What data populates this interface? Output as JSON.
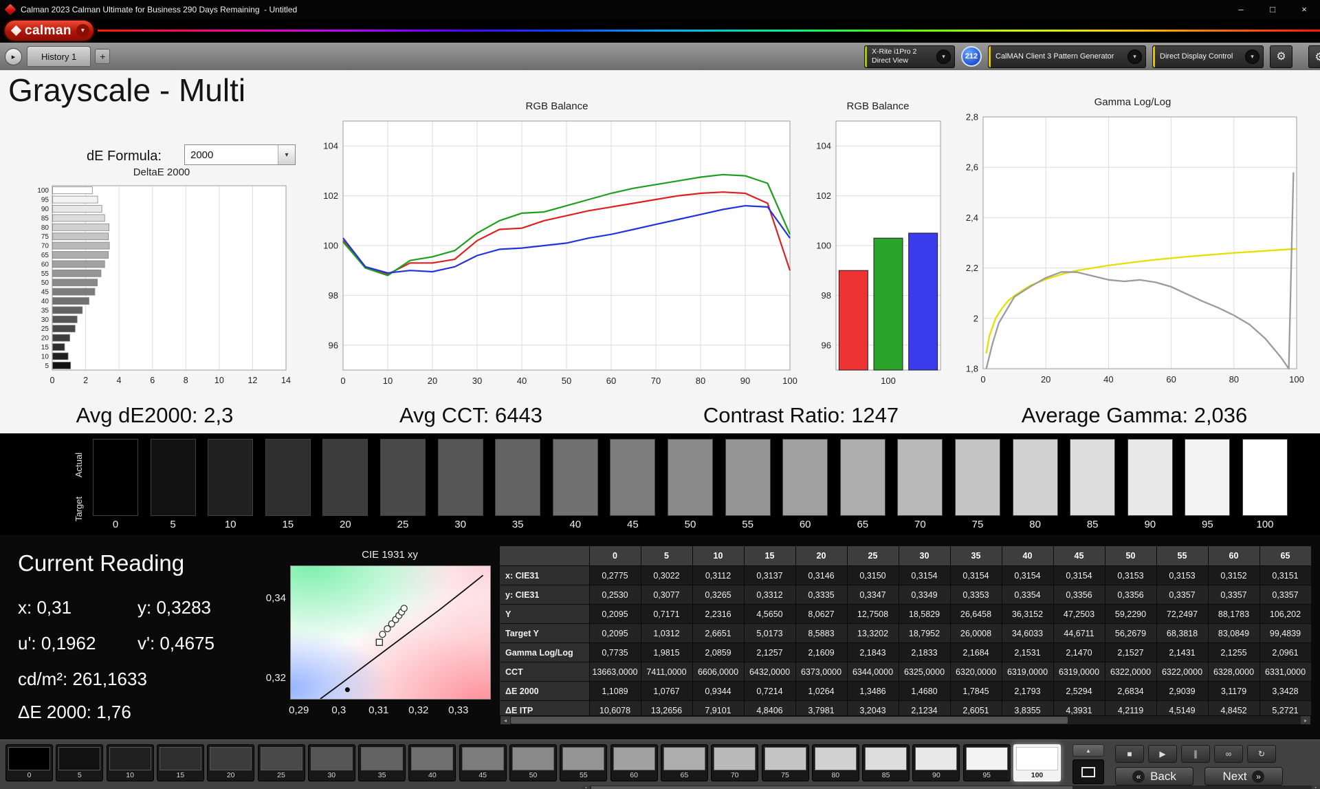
{
  "window": {
    "title": "Calman 2023 Calman Ultimate for Business 290 Days Remaining  - Untitled"
  },
  "icons": {
    "minimize": "–",
    "maximize": "□",
    "close": "×",
    "caret_down": "▾",
    "nav_next": "▸",
    "add_tab": "+",
    "gear": "⚙",
    "scroll_left": "◂",
    "scroll_right": "▸",
    "chevron_up": "▲"
  },
  "logo": {
    "text": "calman"
  },
  "tabbar": {
    "history_tab": "History 1",
    "meter": {
      "line1": "X-Rite i1Pro 2",
      "line2": "Direct View",
      "accent": "#a8c800"
    },
    "badge": "212",
    "pattern_generator": {
      "label": "CalMAN Client 3 Pattern Generator",
      "accent": "#e2c600"
    },
    "display_control": {
      "label": "Direct Display Control",
      "accent": "#e2c600"
    }
  },
  "page": {
    "title": "Grayscale - Multi",
    "de_formula_label": "dE Formula:",
    "de_formula_value": "2000"
  },
  "summary": {
    "avg_de": "Avg dE2000: 2,3",
    "avg_cct": "Avg CCT: 6443",
    "contrast_ratio": "Contrast Ratio: 1247",
    "average_gamma": "Average Gamma: 2,036"
  },
  "swatch_strip": {
    "row_labels": [
      "Actual",
      "Target"
    ],
    "levels": [
      "0",
      "5",
      "10",
      "15",
      "20",
      "25",
      "30",
      "35",
      "40",
      "45",
      "50",
      "55",
      "60",
      "65",
      "70",
      "75",
      "80",
      "85",
      "90",
      "95",
      "100"
    ]
  },
  "current_reading": {
    "title": "Current Reading",
    "values": [
      {
        "label": "x:",
        "value": "0,31"
      },
      {
        "label": "y:",
        "value": "0,3283"
      },
      {
        "label": "u':",
        "value": "0,1962"
      },
      {
        "label": "v':",
        "value": "0,4675"
      },
      {
        "label": "cd/m²:",
        "value": "261,1633"
      },
      {
        "label": "ΔE 2000:",
        "value": "1,76"
      }
    ]
  },
  "measurement_table": {
    "columns": [
      "0",
      "5",
      "10",
      "15",
      "20",
      "25",
      "30",
      "35",
      "40",
      "45",
      "50",
      "55",
      "60",
      "65"
    ],
    "rows": [
      {
        "label": "x: CIE31",
        "values": [
          "0,2775",
          "0,3022",
          "0,3112",
          "0,3137",
          "0,3146",
          "0,3150",
          "0,3154",
          "0,3154",
          "0,3154",
          "0,3154",
          "0,3153",
          "0,3153",
          "0,3152",
          "0,3151"
        ]
      },
      {
        "label": "y: CIE31",
        "values": [
          "0,2530",
          "0,3077",
          "0,3265",
          "0,3312",
          "0,3335",
          "0,3347",
          "0,3349",
          "0,3353",
          "0,3354",
          "0,3356",
          "0,3356",
          "0,3357",
          "0,3357",
          "0,3357"
        ]
      },
      {
        "label": "Y",
        "values": [
          "0,2095",
          "0,7171",
          "2,2316",
          "4,5650",
          "8,0627",
          "12,7508",
          "18,5829",
          "26,6458",
          "36,3152",
          "47,2503",
          "59,2290",
          "72,2497",
          "88,1783",
          "106,202"
        ]
      },
      {
        "label": "Target Y",
        "values": [
          "0,2095",
          "1,0312",
          "2,6651",
          "5,0173",
          "8,5883",
          "13,3202",
          "18,7952",
          "26,0008",
          "34,6033",
          "44,6711",
          "56,2679",
          "68,3818",
          "83,0849",
          "99,4839"
        ]
      },
      {
        "label": "Gamma Log/Log",
        "values": [
          "0,7735",
          "1,9815",
          "2,0859",
          "2,1257",
          "2,1609",
          "2,1843",
          "2,1833",
          "2,1684",
          "2,1531",
          "2,1470",
          "2,1527",
          "2,1431",
          "2,1255",
          "2,0961"
        ]
      },
      {
        "label": "CCT",
        "values": [
          "13663,0000",
          "7411,0000",
          "6606,0000",
          "6432,0000",
          "6373,0000",
          "6344,0000",
          "6325,0000",
          "6320,0000",
          "6319,0000",
          "6319,0000",
          "6322,0000",
          "6322,0000",
          "6328,0000",
          "6331,0000"
        ]
      },
      {
        "label": "ΔE 2000",
        "values": [
          "1,1089",
          "1,0767",
          "0,9344",
          "0,7214",
          "1,0264",
          "1,3486",
          "1,4680",
          "1,7845",
          "2,1793",
          "2,5294",
          "2,6834",
          "2,9039",
          "3,1179",
          "3,3428"
        ]
      },
      {
        "label": "ΔE ITP",
        "values": [
          "10,6078",
          "13,2656",
          "7,9101",
          "4,8406",
          "3,7981",
          "3,2043",
          "2,1234",
          "2,6051",
          "3,8355",
          "4,3931",
          "4,2119",
          "4,5149",
          "4,8452",
          "5,2721"
        ]
      }
    ]
  },
  "patch_bar": {
    "levels": [
      "0",
      "5",
      "10",
      "15",
      "20",
      "25",
      "30",
      "35",
      "40",
      "45",
      "50",
      "55",
      "60",
      "65",
      "70",
      "75",
      "80",
      "85",
      "90",
      "95",
      "100"
    ],
    "selected": "100",
    "transport": [
      {
        "name": "stop",
        "glyph": "■"
      },
      {
        "name": "play",
        "glyph": "▶"
      },
      {
        "name": "pause",
        "glyph": "∥"
      },
      {
        "name": "loop",
        "glyph": "∞"
      },
      {
        "name": "refresh",
        "glyph": "↻"
      }
    ],
    "back": "Back",
    "next": "Next",
    "back_icon": "«",
    "next_icon": "»"
  },
  "chart_data": [
    {
      "id": "delta_e",
      "type": "bar",
      "orientation": "horizontal",
      "title": "DeltaE 2000",
      "categories": [
        5,
        10,
        15,
        20,
        25,
        30,
        35,
        40,
        45,
        50,
        55,
        60,
        65,
        70,
        75,
        80,
        85,
        90,
        95,
        100
      ],
      "values": [
        1.08,
        0.93,
        0.72,
        1.03,
        1.35,
        1.47,
        1.78,
        2.18,
        2.53,
        2.68,
        2.9,
        3.12,
        3.34,
        3.4,
        3.34,
        3.38,
        3.12,
        2.95,
        2.7,
        2.38
      ],
      "xlim": [
        0,
        14
      ],
      "x_ticks": [
        0,
        2,
        4,
        6,
        8,
        10,
        12,
        14
      ]
    },
    {
      "id": "rgb_balance_line",
      "type": "line",
      "title": "RGB Balance",
      "x": [
        0,
        5,
        10,
        15,
        20,
        25,
        30,
        35,
        40,
        45,
        50,
        55,
        60,
        65,
        70,
        75,
        80,
        85,
        90,
        95,
        100
      ],
      "series": [
        {
          "name": "Red",
          "color": "#dd2020",
          "values": [
            100.2,
            99.1,
            98.85,
            99.3,
            99.3,
            99.45,
            100.2,
            100.65,
            100.7,
            101.0,
            101.2,
            101.4,
            101.55,
            101.7,
            101.85,
            102.0,
            102.1,
            102.15,
            102.1,
            101.7,
            99.0
          ]
        },
        {
          "name": "Green",
          "color": "#1d9e1d",
          "values": [
            100.15,
            99.1,
            98.8,
            99.4,
            99.55,
            99.8,
            100.5,
            101.0,
            101.3,
            101.35,
            101.6,
            101.85,
            102.1,
            102.3,
            102.45,
            102.6,
            102.75,
            102.85,
            102.8,
            102.5,
            100.45
          ]
        },
        {
          "name": "Blue",
          "color": "#2233dd",
          "values": [
            100.3,
            99.15,
            98.9,
            99.0,
            98.95,
            99.15,
            99.6,
            99.85,
            99.9,
            100.0,
            100.1,
            100.3,
            100.45,
            100.65,
            100.85,
            101.05,
            101.25,
            101.45,
            101.6,
            101.55,
            100.3
          ]
        }
      ],
      "ylim": [
        95,
        105
      ],
      "y_ticks": [
        96,
        98,
        100,
        102,
        104
      ],
      "x_ticks": [
        0,
        10,
        20,
        30,
        40,
        50,
        60,
        70,
        80,
        90,
        100
      ]
    },
    {
      "id": "rgb_balance_bars",
      "type": "bar",
      "title": "RGB Balance",
      "categories": [
        "Red",
        "Green",
        "Blue"
      ],
      "values": [
        99.0,
        100.3,
        100.5
      ],
      "colors": [
        "#ee3333",
        "#2aa42a",
        "#3b3bee"
      ],
      "ylim": [
        95,
        105
      ],
      "y_ticks": [
        96,
        98,
        100,
        102,
        104
      ],
      "x_label": "100"
    },
    {
      "id": "gamma_log_log",
      "type": "line",
      "title": "Gamma Log/Log",
      "xlim": [
        0,
        100
      ],
      "ylim": [
        1.8,
        2.8
      ],
      "x_ticks": [
        0,
        20,
        40,
        60,
        80,
        100
      ],
      "y_ticks": [
        1.8,
        2.0,
        2.2,
        2.4,
        2.6,
        2.8
      ],
      "y_tick_labels": [
        "1,8",
        "2",
        "2,2",
        "2,4",
        "2,6",
        "2,8"
      ],
      "series": [
        {
          "name": "Target",
          "color": "#e6df00",
          "points": [
            [
              1,
              1.86
            ],
            [
              2,
              1.93
            ],
            [
              4,
              2.0
            ],
            [
              6,
              2.04
            ],
            [
              8,
              2.07
            ],
            [
              10,
              2.09
            ],
            [
              15,
              2.13
            ],
            [
              20,
              2.155
            ],
            [
              25,
              2.175
            ],
            [
              30,
              2.19
            ],
            [
              35,
              2.2
            ],
            [
              40,
              2.21
            ],
            [
              45,
              2.218
            ],
            [
              50,
              2.226
            ],
            [
              55,
              2.233
            ],
            [
              60,
              2.239
            ],
            [
              65,
              2.245
            ],
            [
              70,
              2.25
            ],
            [
              75,
              2.255
            ],
            [
              80,
              2.26
            ],
            [
              85,
              2.264
            ],
            [
              90,
              2.268
            ],
            [
              95,
              2.272
            ],
            [
              100,
              2.276
            ]
          ]
        },
        {
          "name": "Measured",
          "color": "#9b9b9b",
          "points": [
            [
              1,
              1.8
            ],
            [
              3,
              1.9
            ],
            [
              5,
              1.9815
            ],
            [
              10,
              2.0859
            ],
            [
              15,
              2.1257
            ],
            [
              20,
              2.1609
            ],
            [
              25,
              2.1843
            ],
            [
              30,
              2.1833
            ],
            [
              35,
              2.1684
            ],
            [
              40,
              2.1531
            ],
            [
              45,
              2.147
            ],
            [
              50,
              2.1527
            ],
            [
              55,
              2.1431
            ],
            [
              60,
              2.1255
            ],
            [
              65,
              2.0961
            ],
            [
              70,
              2.068
            ],
            [
              75,
              2.042
            ],
            [
              80,
              2.012
            ],
            [
              85,
              1.975
            ],
            [
              90,
              1.92
            ],
            [
              95,
              1.845
            ],
            [
              97.5,
              1.8
            ],
            [
              99,
              2.58
            ]
          ]
        }
      ]
    },
    {
      "id": "cie_1931_xy",
      "type": "scatter",
      "title": "CIE 1931 xy",
      "xlim": [
        0.2878,
        0.3378
      ],
      "ylim": [
        0.315,
        0.3483
      ],
      "x_ticks": [
        0.29,
        0.3,
        0.31,
        0.32,
        0.33
      ],
      "x_tick_labels": [
        "0,29",
        "0,3",
        "0,31",
        "0,32",
        "0,33"
      ],
      "y_ticks": [
        0.32,
        0.34
      ],
      "y_tick_labels": [
        "0,32",
        "0,34"
      ],
      "locus": [
        [
          0.2952,
          0.315
        ],
        [
          0.301,
          0.3193
        ],
        [
          0.307,
          0.3238
        ],
        [
          0.313,
          0.3283
        ],
        [
          0.319,
          0.3328
        ],
        [
          0.325,
          0.3373
        ],
        [
          0.331,
          0.342
        ],
        [
          0.336,
          0.346
        ]
      ],
      "points": [
        [
          0.3108,
          0.3312
        ],
        [
          0.312,
          0.3326
        ],
        [
          0.3131,
          0.3338
        ],
        [
          0.3141,
          0.3349
        ],
        [
          0.3149,
          0.3359
        ],
        [
          0.3156,
          0.3368
        ],
        [
          0.3162,
          0.3377
        ]
      ],
      "target_square": [
        0.31,
        0.3292
      ],
      "reference_dot": [
        0.302,
        0.3173
      ]
    }
  ]
}
